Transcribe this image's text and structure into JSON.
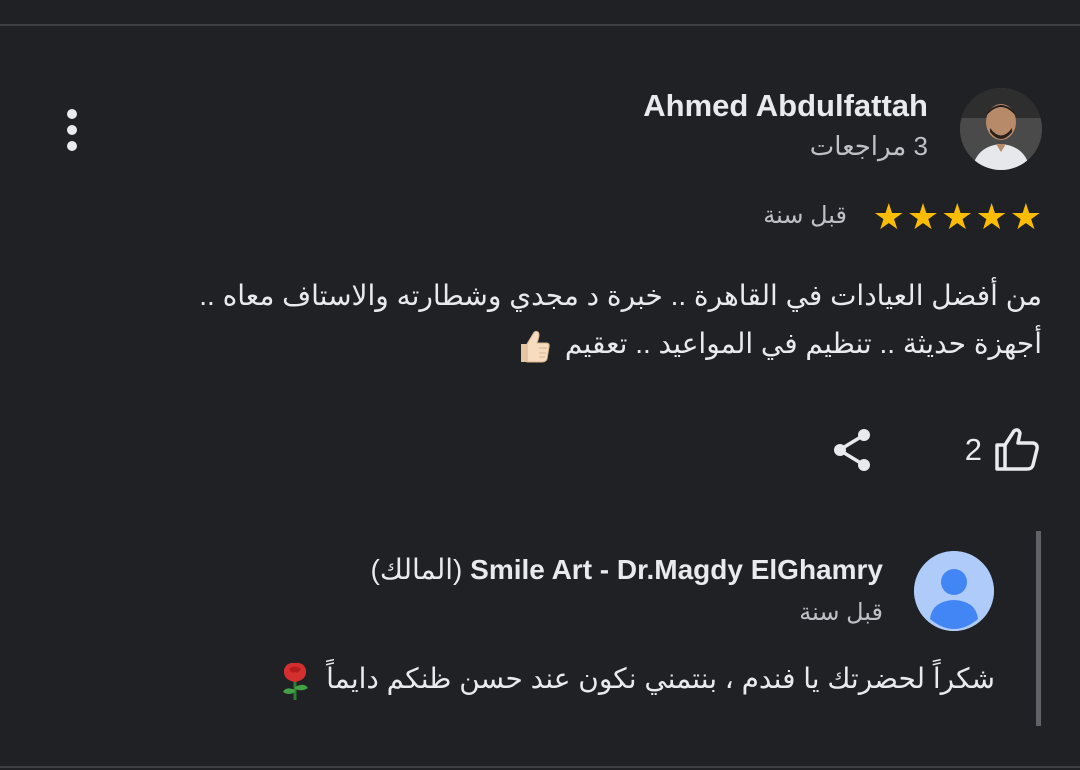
{
  "review": {
    "reviewer_name": "Ahmed Abdulfattah",
    "reviewer_meta": "3 مراجعات",
    "rating": 5,
    "time": "قبل سنة",
    "text_line1": "من أفضل العيادات في القاهرة .. خبرة د مجدي وشطارته والاستاف معاه ..",
    "text_line2": "أجهزة حديثة .. تنظيم في المواعيد .. تعقيم",
    "emoji": "thumbs-up-emoji",
    "likes": "2"
  },
  "reply": {
    "owner_name": "Smile Art - Dr.Magdy ElGhamry",
    "owner_tag": "(المالك)",
    "time": "قبل سنة",
    "text": "شكراً لحضرتك يا فندم ، بنتمني نكون عند حسن ظنكم دايماً",
    "emoji": "rose-emoji"
  },
  "icons": {
    "more": "more-vert-icon",
    "like": "thumb-up-icon",
    "share": "share-icon",
    "star": "star-icon"
  },
  "colors": {
    "background": "#202124",
    "star": "#fbbc04",
    "text": "#e8eaed",
    "secondary_text": "#bdc1c6",
    "owner_avatar_bg": "#aecbfa",
    "owner_avatar_fg": "#4285f4"
  }
}
